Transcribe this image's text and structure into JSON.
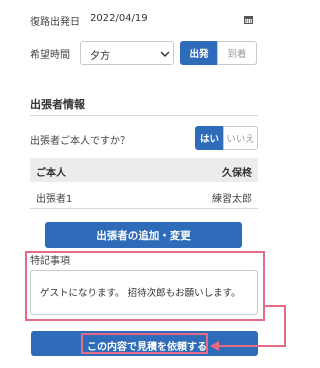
{
  "form": {
    "return_date_label": "復路出発日",
    "return_date_value": "2022/04/19",
    "desired_time_label": "希望時間",
    "desired_time_value": "夕方",
    "time_mode_depart": "出発",
    "time_mode_arrive": "到着"
  },
  "traveler": {
    "section_title": "出張者情報",
    "is_self_question": "出張者ご本人ですか？",
    "yes": "はい",
    "no": "いいえ",
    "header_left": "ご本人",
    "header_right": "久保柊",
    "row_label": "出張者1",
    "row_value": "練習太郎",
    "add_change_button": "出張者の追加・変更"
  },
  "notes": {
    "label": "特記事項",
    "value": "ゲストになります。 招待次郎もお願いします。"
  },
  "submit": {
    "label": "この内容で見積を依頼する"
  },
  "colors": {
    "primary": "#2e6bb8",
    "highlight": "#e86b86"
  }
}
